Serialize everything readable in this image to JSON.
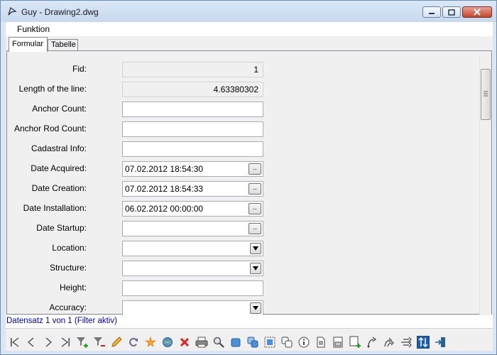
{
  "window": {
    "title": "Guy - Drawing2.dwg",
    "icon": "drawing-app-icon",
    "controls": [
      "minimize-icon",
      "maximize-icon",
      "close-icon"
    ]
  },
  "menu": {
    "items": [
      "Funktion"
    ]
  },
  "tabs": [
    {
      "label": "Formular",
      "active": true
    },
    {
      "label": "Tabelle",
      "active": false
    }
  ],
  "fields": [
    {
      "label": "Fid:",
      "value": "1",
      "kind": "readonly"
    },
    {
      "label": "Length of the line:",
      "value": "4.63380302",
      "kind": "readonly"
    },
    {
      "label": "Anchor Count:",
      "value": "",
      "kind": "text"
    },
    {
      "label": "Anchor Rod Count:",
      "value": "",
      "kind": "text"
    },
    {
      "label": "Cadastral Info:",
      "value": "",
      "kind": "text"
    },
    {
      "label": "Date Acquired:",
      "value": "07.02.2012 18:54:30",
      "kind": "date",
      "button": ".."
    },
    {
      "label": "Date Creation:",
      "value": "07.02.2012 18:54:33",
      "kind": "date",
      "button": ".."
    },
    {
      "label": "Date Installation:",
      "value": "06.02.2012 00:00:00",
      "kind": "date",
      "button": ".."
    },
    {
      "label": "Date Startup:",
      "value": "",
      "kind": "date",
      "button": ".."
    },
    {
      "label": "Location:",
      "value": "",
      "kind": "select"
    },
    {
      "label": "Structure:",
      "value": "",
      "kind": "select"
    },
    {
      "label": "Height:",
      "value": "",
      "kind": "text"
    },
    {
      "label": "Accuracy:",
      "value": "",
      "kind": "select"
    }
  ],
  "status": {
    "text": "Datensatz 1 von 1 (Filter aktiv)",
    "color": "#0000c8"
  },
  "toolbar": {
    "buttons": [
      "first-record-icon",
      "previous-record-icon",
      "next-record-icon",
      "last-record-icon",
      "add-filter-icon",
      "remove-filter-icon",
      "edit-pencil-icon",
      "refresh-icon",
      "highlight-icon",
      "globe-refresh-icon",
      "delete-icon",
      "print-icon",
      "zoom-icon",
      "select-object-icon",
      "select-multiple-icon",
      "select-area-icon",
      "copy-objects-icon",
      "info-icon",
      "document-icon",
      "form-icon",
      "form-add-icon",
      "connect-icon",
      "connect-multiple-icon",
      "network-icon",
      "sort-icon",
      "exit-icon"
    ]
  }
}
